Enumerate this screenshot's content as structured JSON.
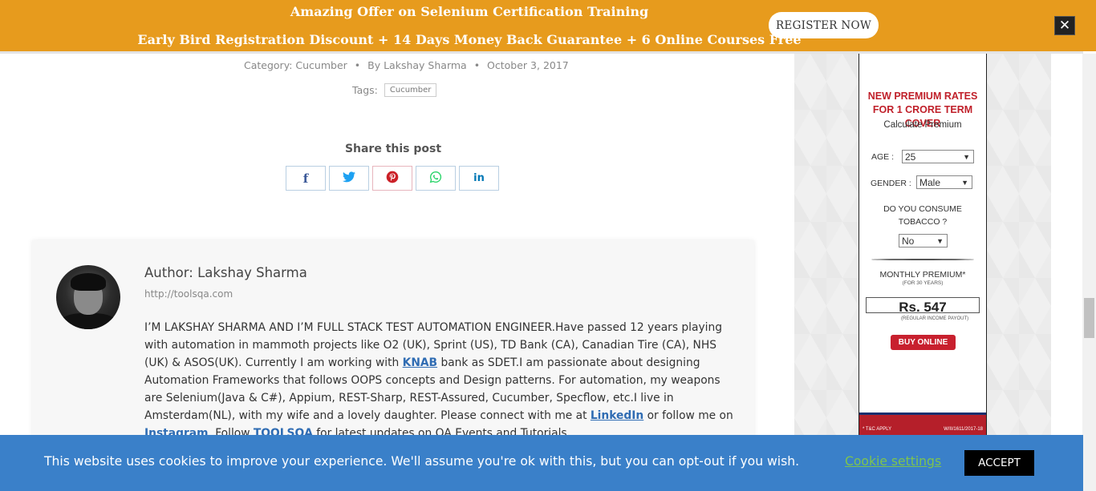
{
  "promo": {
    "line1": "Amazing Offer on Selenium Certification Training",
    "line2": "Early Bird Registration Discount + 14 Days Money Back Guarantee + 6 Online Courses Free",
    "register_label": "REGISTER NOW",
    "close_glyph": "✕",
    "background_color": "#e79b1d"
  },
  "post_meta": {
    "category_label": "Category:",
    "category": "Cucumber",
    "separator": "•",
    "author_prefix": "By",
    "author": "Lakshay Sharma",
    "date": "October 3, 2017",
    "tags_label": "Tags:",
    "tag": "Cucumber"
  },
  "share": {
    "title": "Share this post",
    "buttons": [
      {
        "name": "facebook",
        "glyph": "f",
        "icon": "facebook-icon"
      },
      {
        "name": "twitter",
        "glyph": "🐦",
        "icon": "twitter-icon"
      },
      {
        "name": "pinterest",
        "glyph": "℗",
        "icon": "pinterest-icon"
      },
      {
        "name": "whatsapp",
        "glyph": "✆",
        "icon": "whatsapp-icon"
      },
      {
        "name": "linkedin",
        "glyph": "in",
        "icon": "linkedin-icon"
      }
    ]
  },
  "author_box": {
    "name": "Author: Lakshay Sharma",
    "url": "http://toolsqa.com",
    "bio_part1": "I’M LAKSHAY SHARMA AND I’M FULL STACK TEST AUTOMATION ENGINEER.Have passed 12 years playing with automation in mammoth projects like O2 (UK), Sprint (US), TD Bank (CA), Canadian Tire (CA), NHS (UK) & ASOS(UK). Currently I am working with ",
    "bio_link_knab": "KNAB",
    "bio_part2": " bank as SDET.I am passionate about designing Automation Frameworks that follows OOPS concepts and Design patterns. For automation, my weapons are Selenium(Java & C#), Appium, REST-Sharp, REST-Assured, Cucumber, Specflow, etc.I live in Amsterdam(NL), with my wife and a lovely daughter. Please connect with me at ",
    "bio_link_linkedin": "LinkedIn",
    "bio_part3": " or follow me on ",
    "bio_link_instagram": "Instagram",
    "bio_part4": ". Follow ",
    "bio_link_toolsqa": "TOOLSQA",
    "bio_part5": " for latest updates on QA Events and Tutorials."
  },
  "ad": {
    "headline_1": "NEW PREMIUM RATES",
    "headline_2": "FOR 1 CRORE TERM COVER",
    "calc_label": "Calculate Premium",
    "age_label": "AGE :",
    "age_value": "25",
    "gender_label": "GENDER :",
    "gender_value": "Male",
    "tobacco_line1": "DO YOU CONSUME",
    "tobacco_line2": "TOBACCO ?",
    "tobacco_value": "No",
    "monthly_label": "MONTHLY PREMIUM*",
    "years_label": "(FOR 30 YEARS)",
    "amount": "Rs. 547",
    "payout_label": "(REGULAR INCOME PAYOUT)",
    "buy_label": "BUY ONLINE",
    "tc_label": "* T&C APPLY",
    "code_label": "W/II/1611/2017-18",
    "arrow_glyph": "▼"
  },
  "cookie": {
    "text": "This website uses cookies to improve your experience. We'll assume you're ok with this, but you can opt-out if you wish.",
    "settings_label": "Cookie settings",
    "accept_label": "ACCEPT",
    "background_color": "#3a80c9"
  }
}
